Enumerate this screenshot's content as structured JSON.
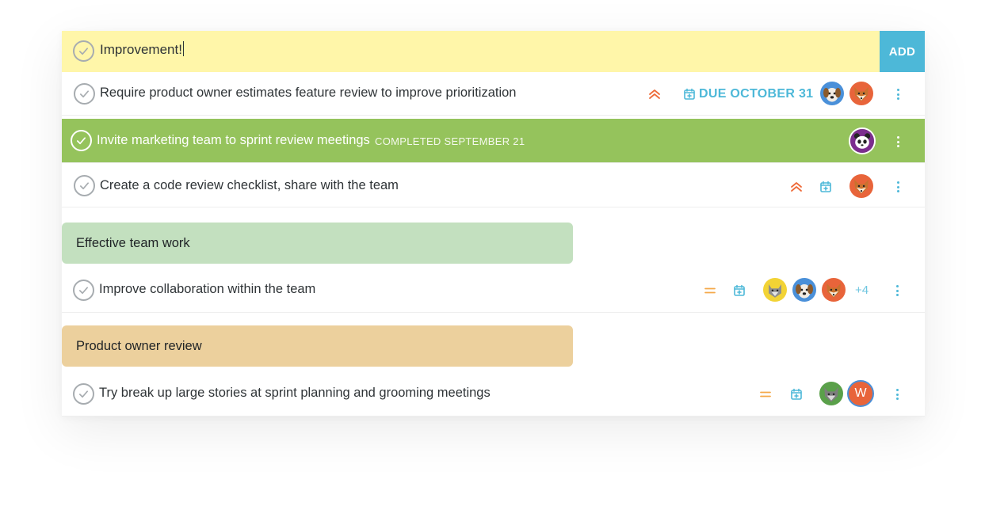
{
  "add": {
    "value": "Improvement!",
    "button_label": "ADD"
  },
  "colors": {
    "accent": "#4db8d8",
    "completed": "#95c35c",
    "priority_high": "#ee6b3a",
    "priority_medium": "#f5a94a",
    "group_green": "#c3e0bf",
    "group_orange": "#ecd09d",
    "input_bg": "#fff6a9"
  },
  "tasks": [
    {
      "title": "Require product owner estimates feature review to improve prioritization",
      "priority": "high",
      "due": "DUE OCTOBER 31",
      "avatars": [
        "dog",
        "fox"
      ]
    },
    {
      "title": "Invite marketing team to sprint review meetings",
      "completed_label": "COMPLETED SEPTEMBER 21",
      "avatars": [
        "panda"
      ]
    },
    {
      "title": "Create a code review checklist, share with the team",
      "priority": "high",
      "avatars": [
        "fox"
      ]
    }
  ],
  "groups": [
    {
      "title": "Effective team work",
      "tasks": [
        {
          "title": "Improve collaboration within the team",
          "priority": "medium",
          "avatars": [
            "cat",
            "dog",
            "fox"
          ],
          "extra_count": "+4"
        }
      ]
    },
    {
      "title": "Product owner review",
      "tasks": [
        {
          "title": "Try break up large stories at sprint planning and grooming meetings",
          "priority": "medium",
          "avatars": [
            "wolf",
            "letter-w"
          ],
          "letter": "W"
        }
      ]
    }
  ]
}
